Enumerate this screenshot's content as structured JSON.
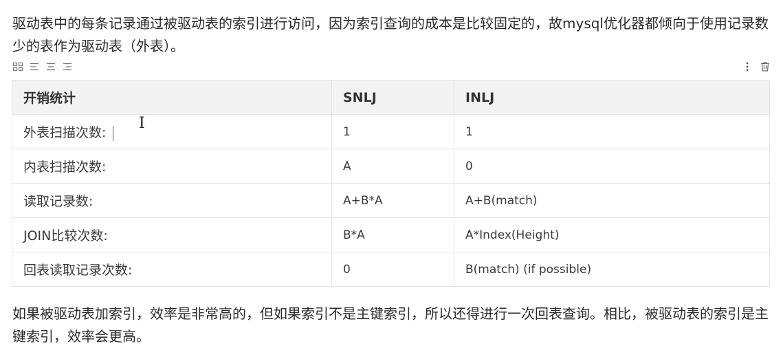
{
  "paragraphs": {
    "intro": "驱动表中的每条记录通过被驱动表的索引进行访问，因为索引查询的成本是比较固定的，故mysql优化器都倾向于使用记录数少的表作为驱动表（外表）。",
    "conclusion": "如果被驱动表加索引，效率是非常高的，但如果索引不是主键索引，所以还得进行一次回表查询。相比，被驱动表的索引是主键索引，效率会更高。"
  },
  "toolbar": {
    "left_icons": [
      "grid-icon",
      "align-left-icon",
      "align-center-icon",
      "align-right-icon"
    ],
    "right_icons": [
      "more-vertical-icon",
      "trash-icon"
    ]
  },
  "table": {
    "headers": [
      "开销统计",
      "SNLJ",
      "INLJ"
    ],
    "rows": [
      [
        "外表扫描次数:",
        "1",
        "1"
      ],
      [
        "内表扫描次数:",
        "A",
        "0"
      ],
      [
        "读取记录数:",
        "A+B*A",
        "A+B(match)"
      ],
      [
        "JOIN比较次数:",
        "B*A",
        "A*Index(Height)"
      ],
      [
        "回表读取记录次数:",
        "0",
        "B(match) (if possible)"
      ]
    ]
  },
  "colors": {
    "header_bg": "#f3f3f3",
    "border": "#e3e3e3",
    "text": "#333333"
  }
}
